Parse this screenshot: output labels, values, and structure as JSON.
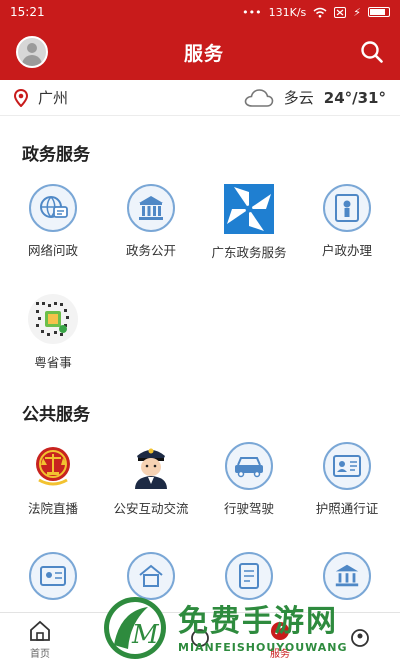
{
  "status_bar": {
    "time": "15:21",
    "network_speed": "131K/s"
  },
  "header": {
    "title": "服务"
  },
  "location": {
    "city": "广州",
    "weather": "多云",
    "temperature": "24°/31°"
  },
  "sections": [
    {
      "title": "政务服务",
      "items": [
        {
          "label": "网络问政",
          "icon": "online-consult-icon"
        },
        {
          "label": "政务公开",
          "icon": "government-building-icon"
        },
        {
          "label": "广东政务服务",
          "icon": "guangdong-gov-logo-icon"
        },
        {
          "label": "户政办理",
          "icon": "household-registration-icon"
        },
        {
          "label": "粤省事",
          "icon": "qr-code-icon"
        }
      ]
    },
    {
      "title": "公共服务",
      "items": [
        {
          "label": "法院直播",
          "icon": "court-emblem-icon"
        },
        {
          "label": "公安互动交流",
          "icon": "police-officer-icon"
        },
        {
          "label": "行驶驾驶",
          "icon": "car-icon"
        },
        {
          "label": "护照通行证",
          "icon": "passport-icon"
        }
      ]
    }
  ],
  "bottom_nav": [
    {
      "label": "首页",
      "icon": "home-icon"
    },
    {
      "label": "",
      "icon": "news-icon"
    },
    {
      "label": "",
      "icon": "video-icon"
    },
    {
      "label": "服务",
      "icon": "service-icon"
    },
    {
      "label": "",
      "icon": "user-icon"
    }
  ],
  "watermark": {
    "title": "免费手游网",
    "subtitle": "MIANFEISHOUYOUWANG"
  },
  "colors": {
    "brand_red": "#c81b1b",
    "icon_blue": "#7aa7d6",
    "watermark_green": "#2e8b3e"
  }
}
